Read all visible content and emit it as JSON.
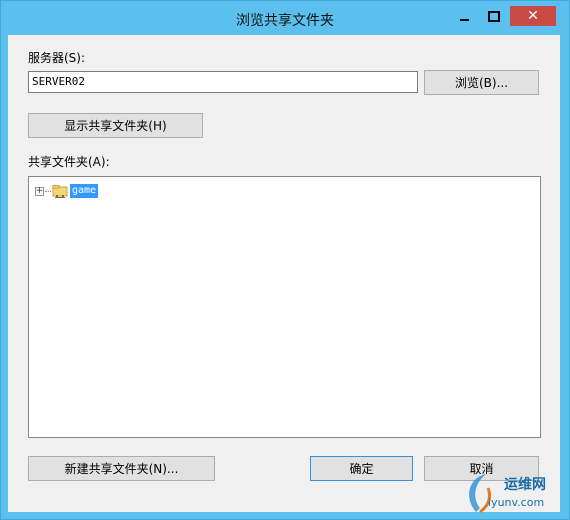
{
  "window": {
    "title": "浏览共享文件夹"
  },
  "controls": {
    "minimize_icon": "minimize-icon",
    "maximize_icon": "maximize-icon",
    "close_symbol": "✕"
  },
  "server": {
    "label": "服务器(S):",
    "value": "SERVER02"
  },
  "buttons": {
    "browse": "浏览(B)...",
    "show_shares": "显示共享文件夹(H)",
    "new_share": "新建共享文件夹(N)...",
    "ok": "确定",
    "cancel": "取消"
  },
  "share_list": {
    "label": "共享文件夹(A):",
    "expander": "+",
    "items": [
      {
        "name": "game",
        "icon": "shared-folder-icon",
        "selected": true
      }
    ]
  },
  "watermark": {
    "line1": "运维网",
    "line2": "iyunv.com"
  },
  "colors": {
    "titlebar": "#5bc0ee",
    "close": "#c74b42",
    "selection": "#3399ff"
  }
}
